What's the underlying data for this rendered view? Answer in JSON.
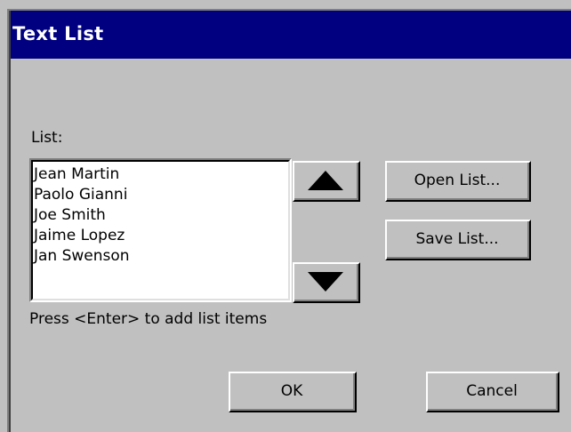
{
  "window": {
    "title": "Text List"
  },
  "list": {
    "label": "List:",
    "items": [
      "Jean Martin",
      "Paolo Gianni",
      "Joe Smith",
      "Jaime Lopez",
      "Jan Swenson"
    ],
    "hint": "Press <Enter> to add list items"
  },
  "buttons": {
    "move_up_icon": "triangle-up-icon",
    "move_down_icon": "triangle-down-icon",
    "open_list": "Open List...",
    "save_list": "Save List...",
    "ok": "OK",
    "cancel": "Cancel"
  },
  "colors": {
    "titlebar_bg": "#000080",
    "titlebar_text": "#ffffff",
    "dialog_bg": "#c0c0c0",
    "listbox_bg": "#ffffff"
  }
}
